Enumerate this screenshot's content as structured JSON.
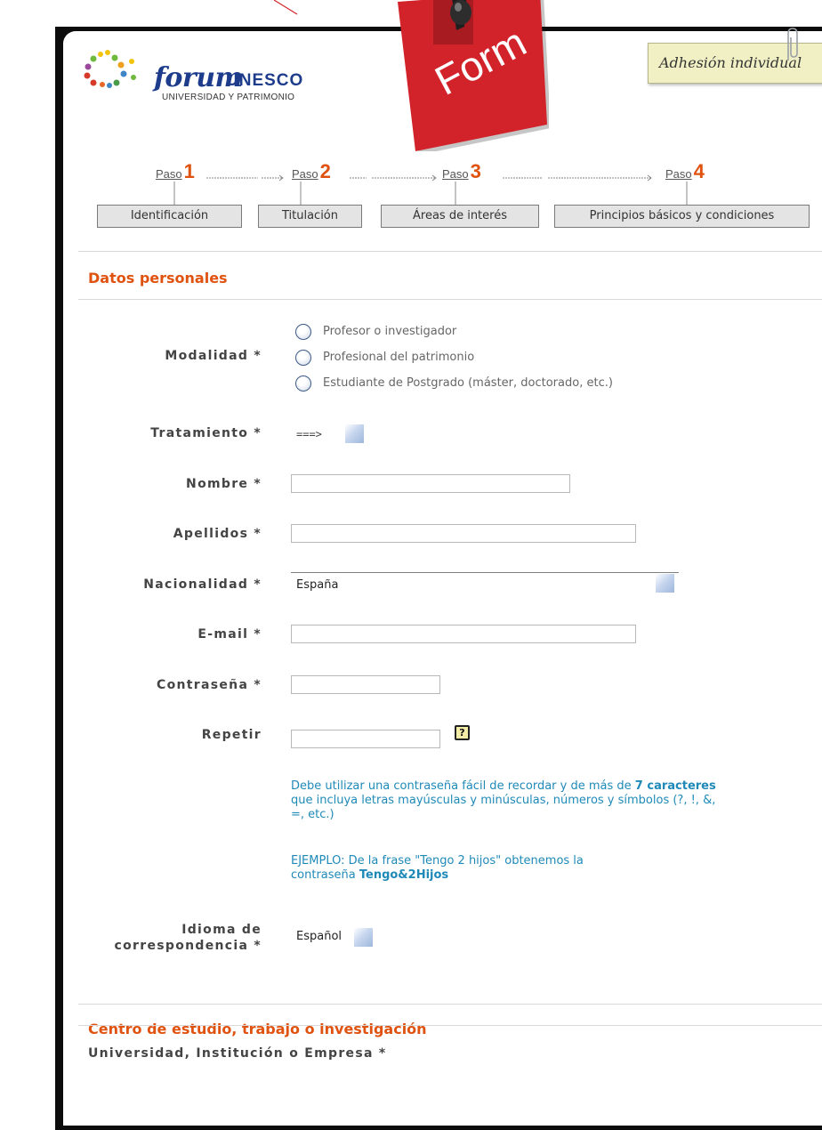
{
  "logo": {
    "forum": "forum",
    "unesco": "UNESCO",
    "subtitle": "UNIVERSIDAD Y PATRIMONIO"
  },
  "sticky_note": {
    "label": "Form",
    "color": "#d2232a"
  },
  "adhesion_tab": {
    "label": "Adhesión individual"
  },
  "steps": [
    {
      "paso": "Paso",
      "number": "1",
      "button": "Identificación"
    },
    {
      "paso": "Paso",
      "number": "2",
      "button": "Titulación"
    },
    {
      "paso": "Paso",
      "number": "3",
      "button": "Áreas de interés"
    },
    {
      "paso": "Paso",
      "number": "4",
      "button": "Principios básicos y condiciones"
    }
  ],
  "colors": {
    "accent": "#e0520f",
    "info": "#1f8ab8",
    "frame": "#0c0c0c"
  },
  "section1": {
    "title": "Datos personales",
    "modalidad": {
      "label": "Modalidad *",
      "options": [
        "Profesor o investigador",
        "Profesional del patrimonio",
        "Estudiante de Postgrado (máster, doctorado, etc.)"
      ]
    },
    "tratamiento": {
      "label": "Tratamiento *",
      "value": "===>"
    },
    "nombre": {
      "label": "Nombre *",
      "value": ""
    },
    "apellidos": {
      "label": "Apellidos *",
      "value": ""
    },
    "nacionalidad": {
      "label": "Nacionalidad *",
      "value": "España"
    },
    "email": {
      "label": "E-mail *",
      "value": ""
    },
    "contrasena": {
      "label": "Contraseña *",
      "value": ""
    },
    "repetir": {
      "label": "Repetir",
      "value": "",
      "help": "?"
    },
    "info1": {
      "pre": "Debe utilizar una contraseña fácil de recordar y de más de ",
      "bold": "7 caracteres",
      "line2": "que incluya letras mayúsculas y minúsculas, números y símbolos (?, !, &,",
      "line3": "=, etc.)"
    },
    "info2": {
      "line1": "EJEMPLO: De la frase \"Tengo 2 hijos\" obtenemos la",
      "pre": "contraseña ",
      "bold": "Tengo&2Hijos"
    },
    "idioma": {
      "label_line1": "Idioma de",
      "label_line2": "correspondencia *",
      "value": "Español"
    }
  },
  "section2": {
    "title": "Centro de estudio, trabajo o investigación",
    "field_label": "Universidad, Institución o Empresa *"
  }
}
